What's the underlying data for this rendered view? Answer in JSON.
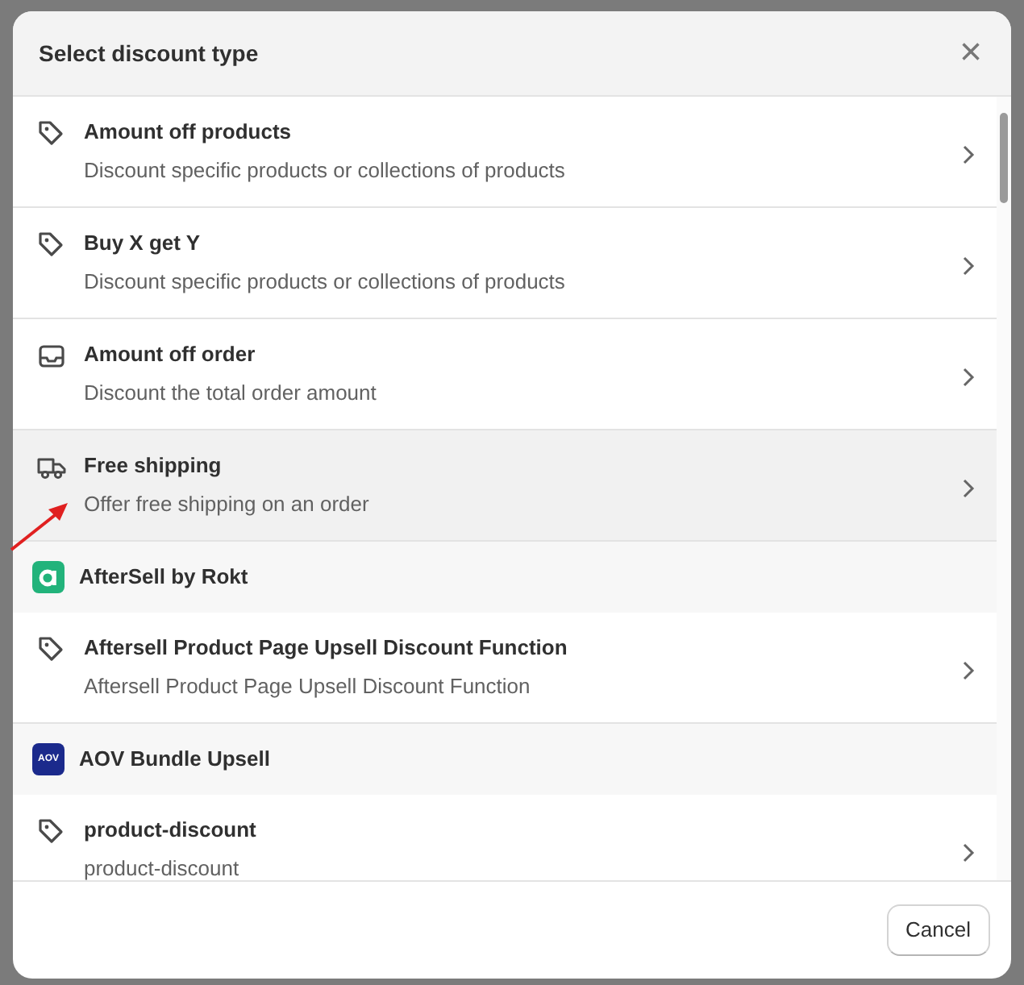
{
  "dialog": {
    "title": "Select discount type",
    "close_symbol": "×"
  },
  "items": [
    {
      "kind": "product",
      "title": "Amount off products",
      "description": "Discount specific products or collections of products",
      "highlighted": false
    },
    {
      "kind": "product",
      "title": "Buy X get Y",
      "description": "Discount specific products or collections of products",
      "highlighted": false
    },
    {
      "kind": "order",
      "title": "Amount off order",
      "description": "Discount the total order amount",
      "highlighted": false
    },
    {
      "kind": "shipping",
      "title": "Free shipping",
      "description": "Offer free shipping on an order",
      "highlighted": true
    },
    {
      "kind": "app",
      "title": "AfterSell by Rokt",
      "color": "#22b37b"
    },
    {
      "kind": "product",
      "title": "Aftersell Product Page Upsell Discount Function",
      "description": "Aftersell Product Page Upsell Discount Function",
      "highlighted": false
    },
    {
      "kind": "app",
      "title": "AOV Bundle Upsell",
      "color": "#1b2a8c",
      "logo_text": "AOV"
    },
    {
      "kind": "product",
      "title": "product-discount",
      "description": "product-discount",
      "highlighted": false
    }
  ],
  "footer": {
    "cancel": "Cancel"
  }
}
